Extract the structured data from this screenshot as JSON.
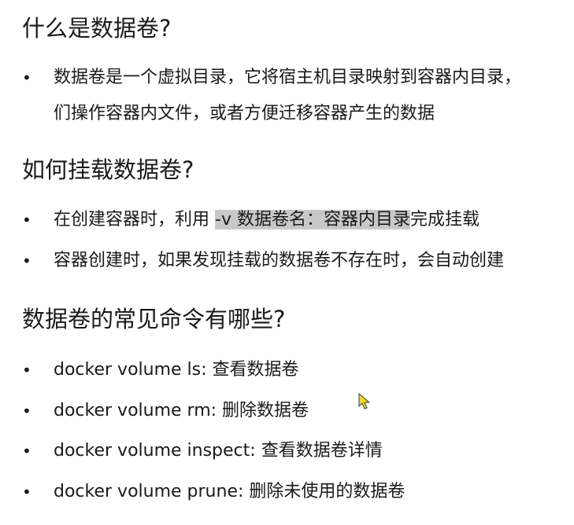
{
  "sections": [
    {
      "heading": "什么是数据卷?",
      "items": [
        {
          "line1": "数据卷是一个虚拟目录，它将宿主机目录映射到容器内目录，",
          "line2": "们操作容器内文件，或者方便迁移容器产生的数据"
        }
      ]
    },
    {
      "heading": "如何挂载数据卷?",
      "items": [
        {
          "before": "在创建容器时，利用 ",
          "highlight": "-v 数据卷名：容器内目录",
          "after": "完成挂载"
        },
        {
          "text": "容器创建时，如果发现挂载的数据卷不存在时，会自动创建"
        }
      ]
    },
    {
      "heading": "数据卷的常见命令有哪些?",
      "items": [
        {
          "text": "docker volume ls: 查看数据卷"
        },
        {
          "text": "docker volume rm: 删除数据卷"
        },
        {
          "text": "docker volume inspect: 查看数据卷详情"
        },
        {
          "text": "docker volume prune:  删除未使用的数据卷"
        }
      ]
    }
  ],
  "bullet_glyph": "•",
  "colors": {
    "text": "#1a1a1a",
    "highlight": "#c8c8c8",
    "cursor_fill": "#e8e020"
  },
  "cursor_icon": "mouse-pointer-icon"
}
